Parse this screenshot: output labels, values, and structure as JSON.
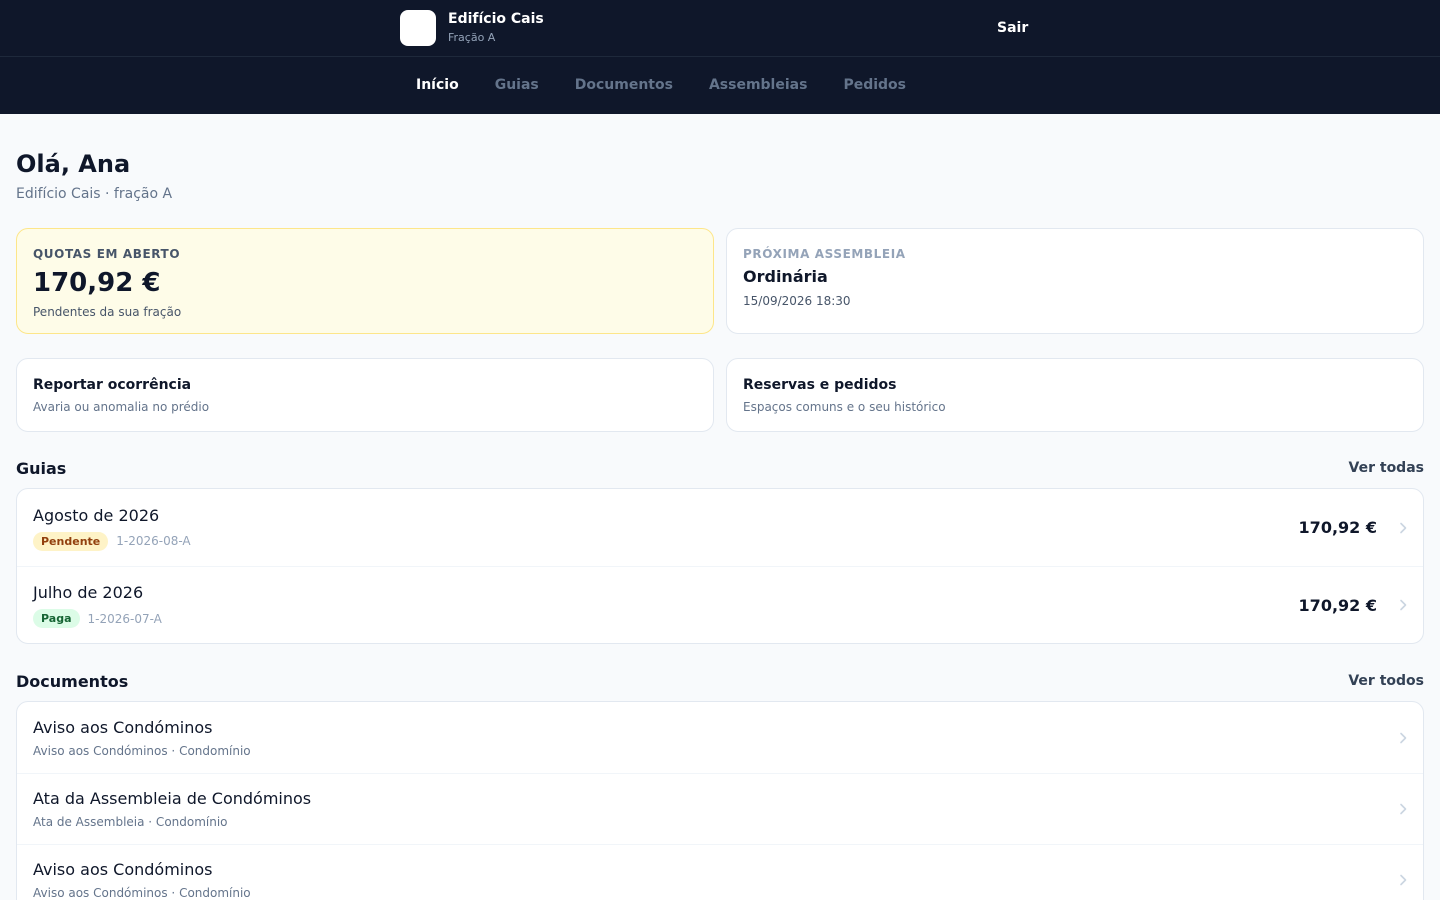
{
  "header": {
    "brand_name": "Edifício Cais",
    "brand_sub": "Fração A",
    "logout_label": "Sair"
  },
  "nav": {
    "items": [
      {
        "label": "Início",
        "active": true
      },
      {
        "label": "Guias"
      },
      {
        "label": "Documentos"
      },
      {
        "label": "Assembleias"
      },
      {
        "label": "Pedidos"
      }
    ]
  },
  "page": {
    "greeting": "Olá, Ana",
    "subtitle": "Edifício Cais · fração A"
  },
  "quota_card": {
    "label": "QUOTAS EM ABERTO",
    "amount": "170,92 €",
    "note": "Pendentes da sua fração"
  },
  "assembly_card": {
    "label": "PRÓXIMA ASSEMBLEIA",
    "type": "Ordinária",
    "datetime": "15/09/2026 18:30"
  },
  "actions": [
    {
      "title": "Reportar ocorrência",
      "subtitle": "Avaria ou anomalia no prédio"
    },
    {
      "title": "Reservas e pedidos",
      "subtitle": "Espaços comuns e o seu histórico"
    }
  ],
  "guides": {
    "title": "Guias",
    "link": "Ver todas",
    "items": [
      {
        "title": "Agosto de 2026",
        "status": "Pendente",
        "ref": "1-2026-08-A",
        "amount": "170,92 €"
      },
      {
        "title": "Julho de 2026",
        "status": "Paga",
        "ref": "1-2026-07-A",
        "amount": "170,92 €"
      }
    ]
  },
  "documents": {
    "title": "Documentos",
    "link": "Ver todos",
    "items": [
      {
        "title": "Aviso aos Condóminos",
        "meta": "Aviso aos Condóminos · Condomínio"
      },
      {
        "title": "Ata da Assembleia de Condóminos",
        "meta": "Ata de Assembleia · Condomínio"
      },
      {
        "title": "Aviso aos Condóminos",
        "meta": "Aviso aos Condóminos · Condomínio"
      }
    ]
  },
  "icons": {
    "chevron": "chevron-right-icon",
    "logo": "building-logo"
  },
  "colors": {
    "header_bg": "#0f172a",
    "quota_bg": "#fefce8",
    "quota_border": "#fde68a",
    "pending_badge_bg": "#fef3c7",
    "pending_badge_text": "#92400e",
    "paid_badge_bg": "#dcfce7",
    "paid_badge_text": "#166534"
  }
}
